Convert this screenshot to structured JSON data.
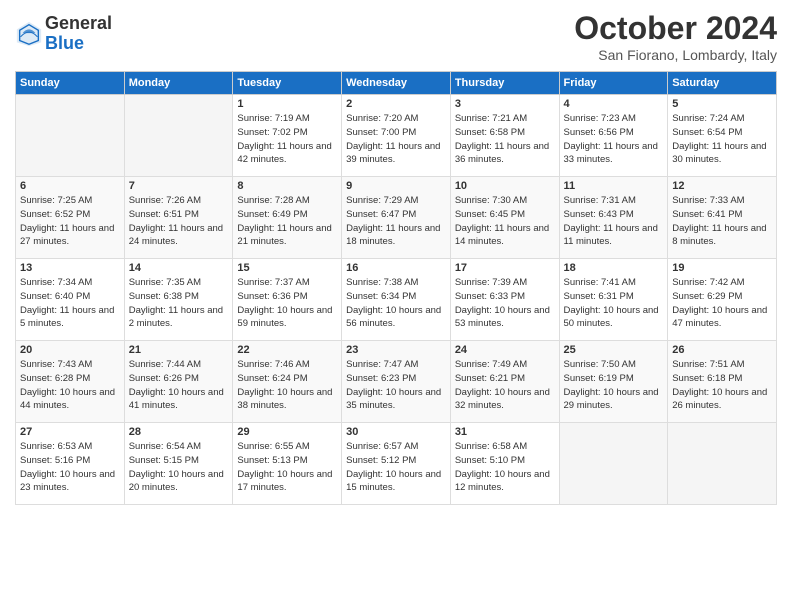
{
  "logo": {
    "general": "General",
    "blue": "Blue"
  },
  "title": "October 2024",
  "location": "San Fiorano, Lombardy, Italy",
  "days_of_week": [
    "Sunday",
    "Monday",
    "Tuesday",
    "Wednesday",
    "Thursday",
    "Friday",
    "Saturday"
  ],
  "weeks": [
    [
      {
        "day": "",
        "info": ""
      },
      {
        "day": "",
        "info": ""
      },
      {
        "day": "1",
        "info": "Sunrise: 7:19 AM\nSunset: 7:02 PM\nDaylight: 11 hours and 42 minutes."
      },
      {
        "day": "2",
        "info": "Sunrise: 7:20 AM\nSunset: 7:00 PM\nDaylight: 11 hours and 39 minutes."
      },
      {
        "day": "3",
        "info": "Sunrise: 7:21 AM\nSunset: 6:58 PM\nDaylight: 11 hours and 36 minutes."
      },
      {
        "day": "4",
        "info": "Sunrise: 7:23 AM\nSunset: 6:56 PM\nDaylight: 11 hours and 33 minutes."
      },
      {
        "day": "5",
        "info": "Sunrise: 7:24 AM\nSunset: 6:54 PM\nDaylight: 11 hours and 30 minutes."
      }
    ],
    [
      {
        "day": "6",
        "info": "Sunrise: 7:25 AM\nSunset: 6:52 PM\nDaylight: 11 hours and 27 minutes."
      },
      {
        "day": "7",
        "info": "Sunrise: 7:26 AM\nSunset: 6:51 PM\nDaylight: 11 hours and 24 minutes."
      },
      {
        "day": "8",
        "info": "Sunrise: 7:28 AM\nSunset: 6:49 PM\nDaylight: 11 hours and 21 minutes."
      },
      {
        "day": "9",
        "info": "Sunrise: 7:29 AM\nSunset: 6:47 PM\nDaylight: 11 hours and 18 minutes."
      },
      {
        "day": "10",
        "info": "Sunrise: 7:30 AM\nSunset: 6:45 PM\nDaylight: 11 hours and 14 minutes."
      },
      {
        "day": "11",
        "info": "Sunrise: 7:31 AM\nSunset: 6:43 PM\nDaylight: 11 hours and 11 minutes."
      },
      {
        "day": "12",
        "info": "Sunrise: 7:33 AM\nSunset: 6:41 PM\nDaylight: 11 hours and 8 minutes."
      }
    ],
    [
      {
        "day": "13",
        "info": "Sunrise: 7:34 AM\nSunset: 6:40 PM\nDaylight: 11 hours and 5 minutes."
      },
      {
        "day": "14",
        "info": "Sunrise: 7:35 AM\nSunset: 6:38 PM\nDaylight: 11 hours and 2 minutes."
      },
      {
        "day": "15",
        "info": "Sunrise: 7:37 AM\nSunset: 6:36 PM\nDaylight: 10 hours and 59 minutes."
      },
      {
        "day": "16",
        "info": "Sunrise: 7:38 AM\nSunset: 6:34 PM\nDaylight: 10 hours and 56 minutes."
      },
      {
        "day": "17",
        "info": "Sunrise: 7:39 AM\nSunset: 6:33 PM\nDaylight: 10 hours and 53 minutes."
      },
      {
        "day": "18",
        "info": "Sunrise: 7:41 AM\nSunset: 6:31 PM\nDaylight: 10 hours and 50 minutes."
      },
      {
        "day": "19",
        "info": "Sunrise: 7:42 AM\nSunset: 6:29 PM\nDaylight: 10 hours and 47 minutes."
      }
    ],
    [
      {
        "day": "20",
        "info": "Sunrise: 7:43 AM\nSunset: 6:28 PM\nDaylight: 10 hours and 44 minutes."
      },
      {
        "day": "21",
        "info": "Sunrise: 7:44 AM\nSunset: 6:26 PM\nDaylight: 10 hours and 41 minutes."
      },
      {
        "day": "22",
        "info": "Sunrise: 7:46 AM\nSunset: 6:24 PM\nDaylight: 10 hours and 38 minutes."
      },
      {
        "day": "23",
        "info": "Sunrise: 7:47 AM\nSunset: 6:23 PM\nDaylight: 10 hours and 35 minutes."
      },
      {
        "day": "24",
        "info": "Sunrise: 7:49 AM\nSunset: 6:21 PM\nDaylight: 10 hours and 32 minutes."
      },
      {
        "day": "25",
        "info": "Sunrise: 7:50 AM\nSunset: 6:19 PM\nDaylight: 10 hours and 29 minutes."
      },
      {
        "day": "26",
        "info": "Sunrise: 7:51 AM\nSunset: 6:18 PM\nDaylight: 10 hours and 26 minutes."
      }
    ],
    [
      {
        "day": "27",
        "info": "Sunrise: 6:53 AM\nSunset: 5:16 PM\nDaylight: 10 hours and 23 minutes."
      },
      {
        "day": "28",
        "info": "Sunrise: 6:54 AM\nSunset: 5:15 PM\nDaylight: 10 hours and 20 minutes."
      },
      {
        "day": "29",
        "info": "Sunrise: 6:55 AM\nSunset: 5:13 PM\nDaylight: 10 hours and 17 minutes."
      },
      {
        "day": "30",
        "info": "Sunrise: 6:57 AM\nSunset: 5:12 PM\nDaylight: 10 hours and 15 minutes."
      },
      {
        "day": "31",
        "info": "Sunrise: 6:58 AM\nSunset: 5:10 PM\nDaylight: 10 hours and 12 minutes."
      },
      {
        "day": "",
        "info": ""
      },
      {
        "day": "",
        "info": ""
      }
    ]
  ]
}
